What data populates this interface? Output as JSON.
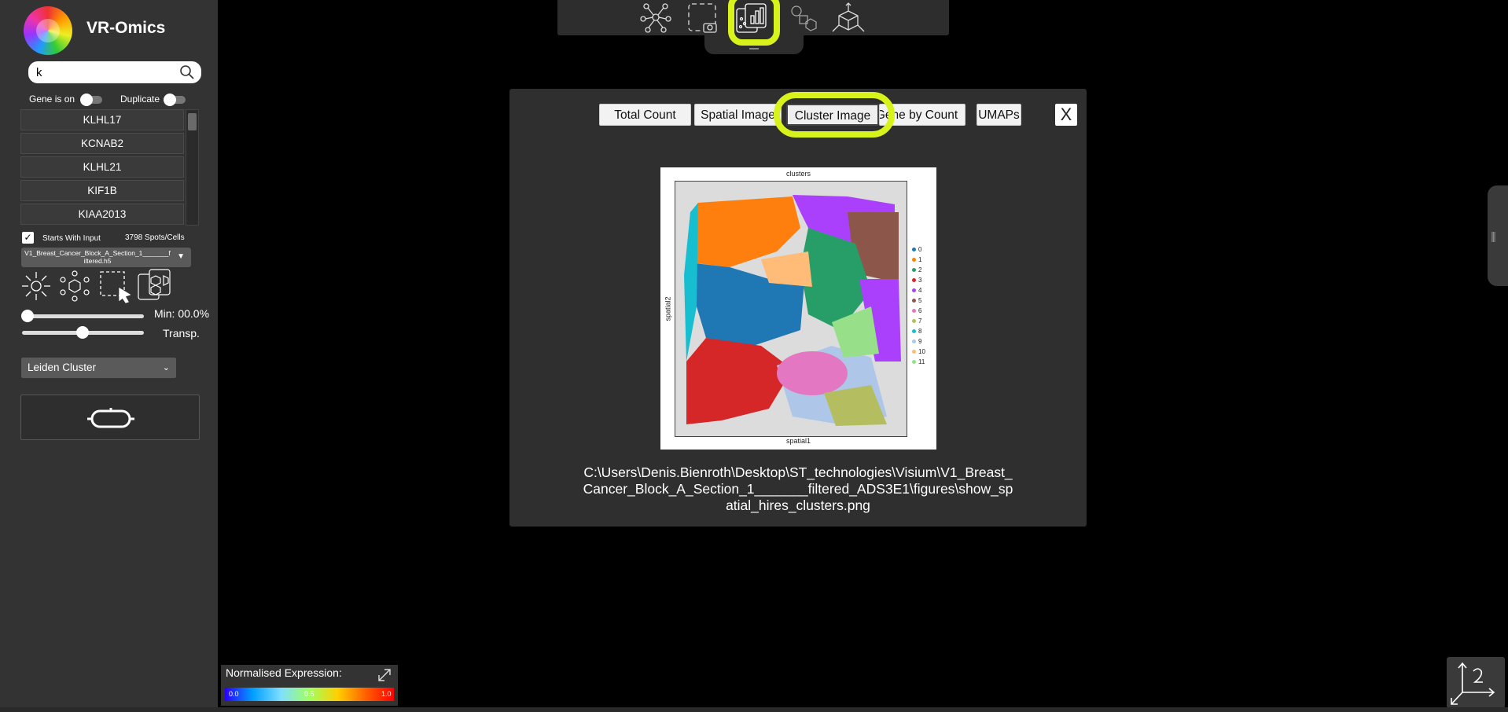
{
  "app": {
    "title": "VR-Omics"
  },
  "search": {
    "value": "k",
    "icon": "search-icon"
  },
  "toggles": {
    "gene_is_on": "Gene is on",
    "duplicate": "Duplicate"
  },
  "gene_list": [
    "KLHL17",
    "KCNAB2",
    "KLHL21",
    "KIF1B",
    "KIAA2013"
  ],
  "starts_with": {
    "label": "Starts With Input",
    "checked_mark": "✓"
  },
  "spots_count": "3798 Spots/Cells",
  "file_dropdown": {
    "value": "V1_Breast_Cancer_Block_A_Section_1_______filtered.h5"
  },
  "sliders": {
    "min_label": "Min: 00.0%",
    "min_level": 0.0,
    "transp_label": "Transp.",
    "transp_level": 0.5
  },
  "cluster_dropdown": {
    "value": "Leiden Cluster"
  },
  "modal": {
    "tabs": [
      "Total Count",
      "Spatial Image",
      "Cluster Image",
      "Gene by Count",
      "UMAPs"
    ],
    "active_tab": "Cluster Image",
    "close_label": "X",
    "figure": {
      "title": "clusters",
      "xlabel": "spatial1",
      "ylabel": "spatial2",
      "legend": [
        {
          "label": "0",
          "color": "#1f77b4"
        },
        {
          "label": "1",
          "color": "#ff7f0e"
        },
        {
          "label": "2",
          "color": "#279e68"
        },
        {
          "label": "3",
          "color": "#d62728"
        },
        {
          "label": "4",
          "color": "#aa40fc"
        },
        {
          "label": "5",
          "color": "#8c564b"
        },
        {
          "label": "6",
          "color": "#e377c2"
        },
        {
          "label": "7",
          "color": "#b5bd61"
        },
        {
          "label": "8",
          "color": "#17becf"
        },
        {
          "label": "9",
          "color": "#aec7e8"
        },
        {
          "label": "10",
          "color": "#ffbb78"
        },
        {
          "label": "11",
          "color": "#98df8a"
        }
      ]
    },
    "file_path": "C:\\Users\\Denis.Bienroth\\Desktop\\ST_technologies\\Visium\\V1_Breast_Cancer_Block_A_Section_1_______filtered_ADS3E1\\figures\\show_spatial_hires_clusters.png"
  },
  "expression_legend": {
    "label": "Normalised Expression:",
    "ticks": [
      "0.0",
      "0.5",
      "1.0"
    ]
  },
  "colors": {
    "highlight": "#d8f31b",
    "sidebar": "#333333",
    "modal": "#2f2f2f"
  }
}
